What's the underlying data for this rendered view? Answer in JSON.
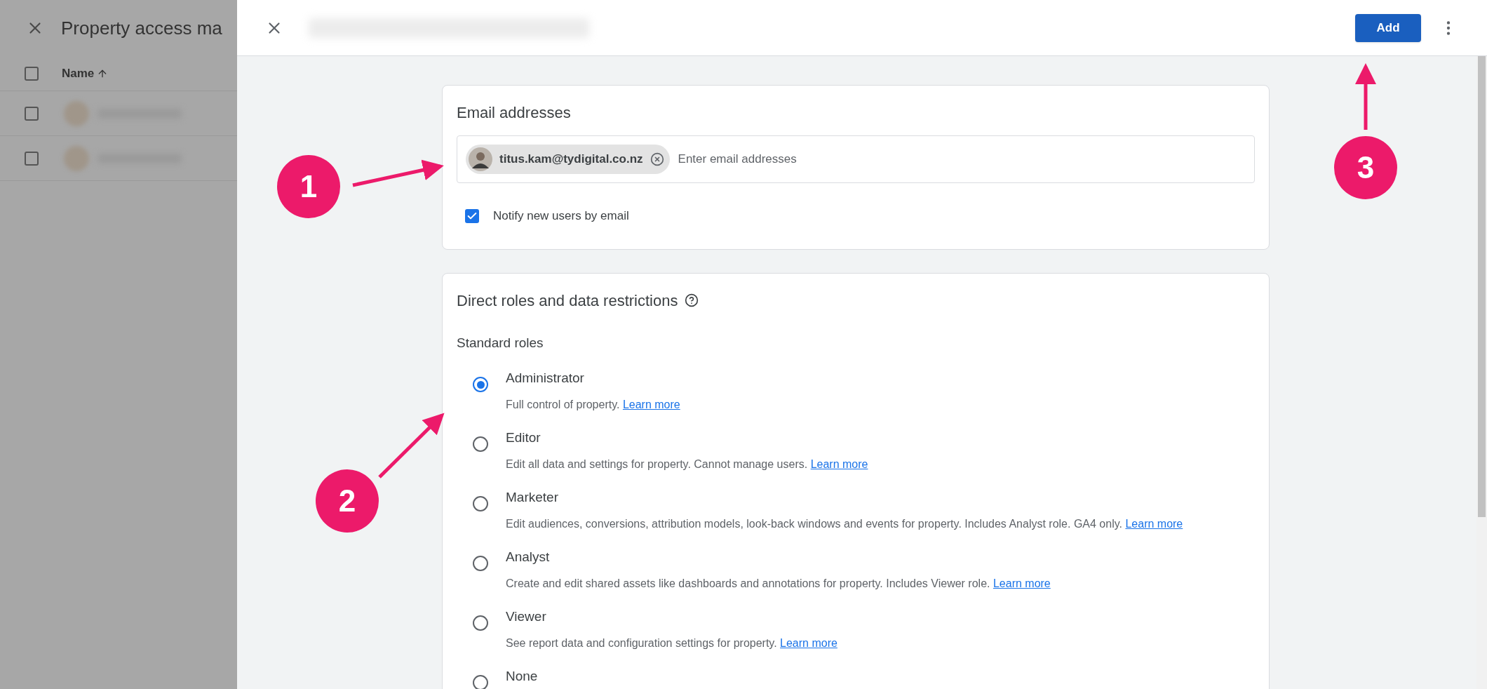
{
  "background_page": {
    "title": "Property access ma",
    "header_checkbox": {
      "checked": false
    },
    "name_column": "Name",
    "rows": [
      {
        "checked": false
      },
      {
        "checked": false
      }
    ]
  },
  "panel": {
    "add_button": "Add"
  },
  "email_card": {
    "title": "Email addresses",
    "chips": [
      {
        "email": "titus.kam@tydigital.co.nz"
      }
    ],
    "placeholder": "Enter email addresses",
    "notify": {
      "label": "Notify new users by email",
      "checked": true
    }
  },
  "roles_card": {
    "title": "Direct roles and data restrictions",
    "subtitle": "Standard roles",
    "roles": [
      {
        "name": "Administrator",
        "description": "Full control of property.",
        "link": "Learn more",
        "selected": true
      },
      {
        "name": "Editor",
        "description": "Edit all data and settings for property. Cannot manage users.",
        "link": "Learn more",
        "selected": false
      },
      {
        "name": "Marketer",
        "description": "Edit audiences, conversions, attribution models, look-back windows and events for property. Includes Analyst role. GA4 only.",
        "link": "Learn more",
        "selected": false
      },
      {
        "name": "Analyst",
        "description": "Create and edit shared assets like dashboards and annotations for property. Includes Viewer role.",
        "link": "Learn more",
        "selected": false
      },
      {
        "name": "Viewer",
        "description": "See report data and configuration settings for property.",
        "link": "Learn more",
        "selected": false
      },
      {
        "name": "None",
        "selected": false
      }
    ]
  },
  "annotations": [
    {
      "number": "1"
    },
    {
      "number": "2"
    },
    {
      "number": "3"
    }
  ]
}
